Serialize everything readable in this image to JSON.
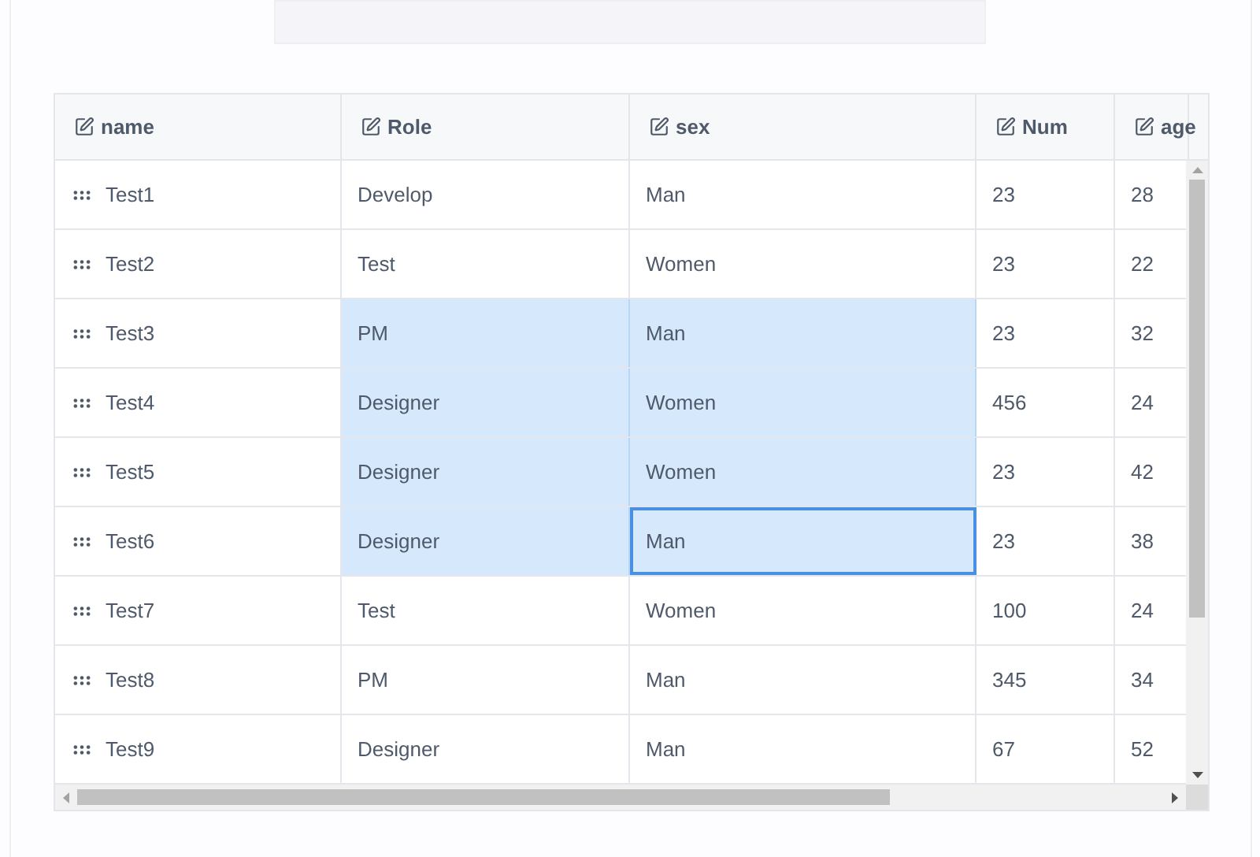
{
  "table": {
    "columns": [
      "name",
      "Role",
      "sex",
      "Num",
      "age"
    ],
    "rows": [
      {
        "cells": [
          {
            "text": "Test1",
            "selected": false,
            "active": false
          },
          {
            "text": "Develop",
            "selected": false,
            "active": false
          },
          {
            "text": "Man",
            "selected": false,
            "active": false
          },
          {
            "text": "23",
            "selected": false,
            "active": false
          },
          {
            "text": "28",
            "selected": false,
            "active": false
          }
        ]
      },
      {
        "cells": [
          {
            "text": "Test2",
            "selected": false,
            "active": false
          },
          {
            "text": "Test",
            "selected": false,
            "active": false
          },
          {
            "text": "Women",
            "selected": false,
            "active": false
          },
          {
            "text": "23",
            "selected": false,
            "active": false
          },
          {
            "text": "22",
            "selected": false,
            "active": false
          }
        ]
      },
      {
        "cells": [
          {
            "text": "Test3",
            "selected": false,
            "active": false
          },
          {
            "text": "PM",
            "selected": true,
            "active": false
          },
          {
            "text": "Man",
            "selected": true,
            "active": false
          },
          {
            "text": "23",
            "selected": false,
            "active": false
          },
          {
            "text": "32",
            "selected": false,
            "active": false
          }
        ]
      },
      {
        "cells": [
          {
            "text": "Test4",
            "selected": false,
            "active": false
          },
          {
            "text": "Designer",
            "selected": true,
            "active": false
          },
          {
            "text": "Women",
            "selected": true,
            "active": false
          },
          {
            "text": "456",
            "selected": false,
            "active": false
          },
          {
            "text": "24",
            "selected": false,
            "active": false
          }
        ]
      },
      {
        "cells": [
          {
            "text": "Test5",
            "selected": false,
            "active": false
          },
          {
            "text": "Designer",
            "selected": true,
            "active": false
          },
          {
            "text": "Women",
            "selected": true,
            "active": false
          },
          {
            "text": "23",
            "selected": false,
            "active": false
          },
          {
            "text": "42",
            "selected": false,
            "active": false
          }
        ]
      },
      {
        "cells": [
          {
            "text": "Test6",
            "selected": false,
            "active": false
          },
          {
            "text": "Designer",
            "selected": true,
            "active": false
          },
          {
            "text": "Man",
            "selected": true,
            "active": true
          },
          {
            "text": "23",
            "selected": false,
            "active": false
          },
          {
            "text": "38",
            "selected": false,
            "active": false
          }
        ]
      },
      {
        "cells": [
          {
            "text": "Test7",
            "selected": false,
            "active": false
          },
          {
            "text": "Test",
            "selected": false,
            "active": false
          },
          {
            "text": "Women",
            "selected": false,
            "active": false
          },
          {
            "text": "100",
            "selected": false,
            "active": false
          },
          {
            "text": "24",
            "selected": false,
            "active": false
          }
        ]
      },
      {
        "cells": [
          {
            "text": "Test8",
            "selected": false,
            "active": false
          },
          {
            "text": "PM",
            "selected": false,
            "active": false
          },
          {
            "text": "Man",
            "selected": false,
            "active": false
          },
          {
            "text": "345",
            "selected": false,
            "active": false
          },
          {
            "text": "34",
            "selected": false,
            "active": false
          }
        ]
      },
      {
        "cells": [
          {
            "text": "Test9",
            "selected": false,
            "active": false
          },
          {
            "text": "Designer",
            "selected": false,
            "active": false
          },
          {
            "text": "Man",
            "selected": false,
            "active": false
          },
          {
            "text": "67",
            "selected": false,
            "active": false
          },
          {
            "text": "52",
            "selected": false,
            "active": false
          }
        ]
      }
    ]
  }
}
